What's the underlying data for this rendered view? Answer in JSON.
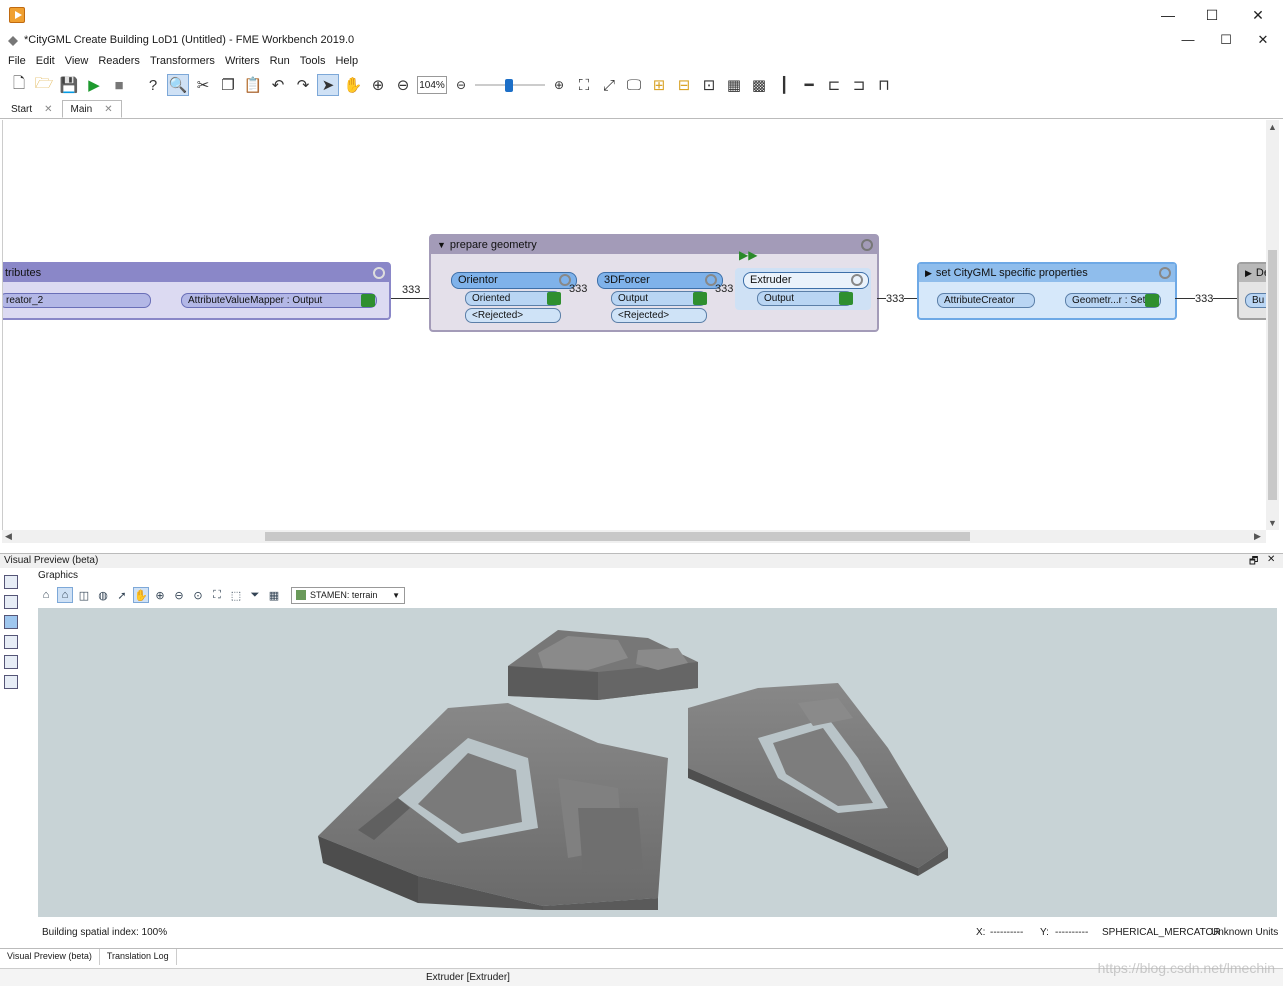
{
  "window": {
    "title": "*CityGML Create Building LoD1 (Untitled) - FME Workbench 2019.0",
    "min": "—",
    "max": "☐",
    "close": "✕"
  },
  "menu": [
    "File",
    "Edit",
    "View",
    "Readers",
    "Transformers",
    "Writers",
    "Run",
    "Tools",
    "Help"
  ],
  "toolbar": {
    "zoom": "104%"
  },
  "tabs": [
    {
      "label": "Start",
      "close": "✕"
    },
    {
      "label": "Main",
      "close": "✕"
    }
  ],
  "canvas": {
    "bm_left": {
      "title": "tributes",
      "node1": "reator_2",
      "node2": "AttributeValueMapper : Output",
      "count": "333"
    },
    "bm_prepare": {
      "title": "prepare geometry",
      "orientor": "Orientor",
      "orientor_out": "Oriented",
      "orientor_rej": "<Rejected>",
      "forcer": "3DForcer",
      "forcer_out": "Output",
      "forcer_rej": "<Rejected>",
      "extruder": "Extruder",
      "extruder_out": "Output",
      "count1": "333",
      "count2": "333",
      "count3": "333"
    },
    "bm_citygml": {
      "title": "set CityGML specific properties",
      "node1": "AttributeCreator",
      "node2": "Geometr...r : Set",
      "count": "333"
    },
    "bm_right": {
      "title": "De",
      "node1": "Bu"
    }
  },
  "preview": {
    "pane_title": "Visual Preview (beta)",
    "graphics_label": "Graphics",
    "basemap": "STAMEN: terrain",
    "status_left": "Building spatial index: 100%",
    "x_label": "X:",
    "x_value": "----------",
    "y_label": "Y:",
    "y_value": "----------",
    "projection": "SPHERICAL_MERCATOR",
    "units": "Unknown Units"
  },
  "bottom_tabs": [
    "Visual Preview (beta)",
    "Translation Log"
  ],
  "footer_status": "Extruder [Extruder]",
  "watermark": "https://blog.csdn.net/lmechin",
  "colors": {
    "bm_purple": "#8a87c8",
    "bm_purple_bg": "#dcdaf2",
    "bm_prepare": "#a39bb8",
    "bm_prepare_bg": "#e4e0ea",
    "bm_blue": "#6ea9e6",
    "bm_blue_bg": "#d6e8fa",
    "viewport_bg": "#c8d3d6",
    "building": "#6e6e6e"
  }
}
